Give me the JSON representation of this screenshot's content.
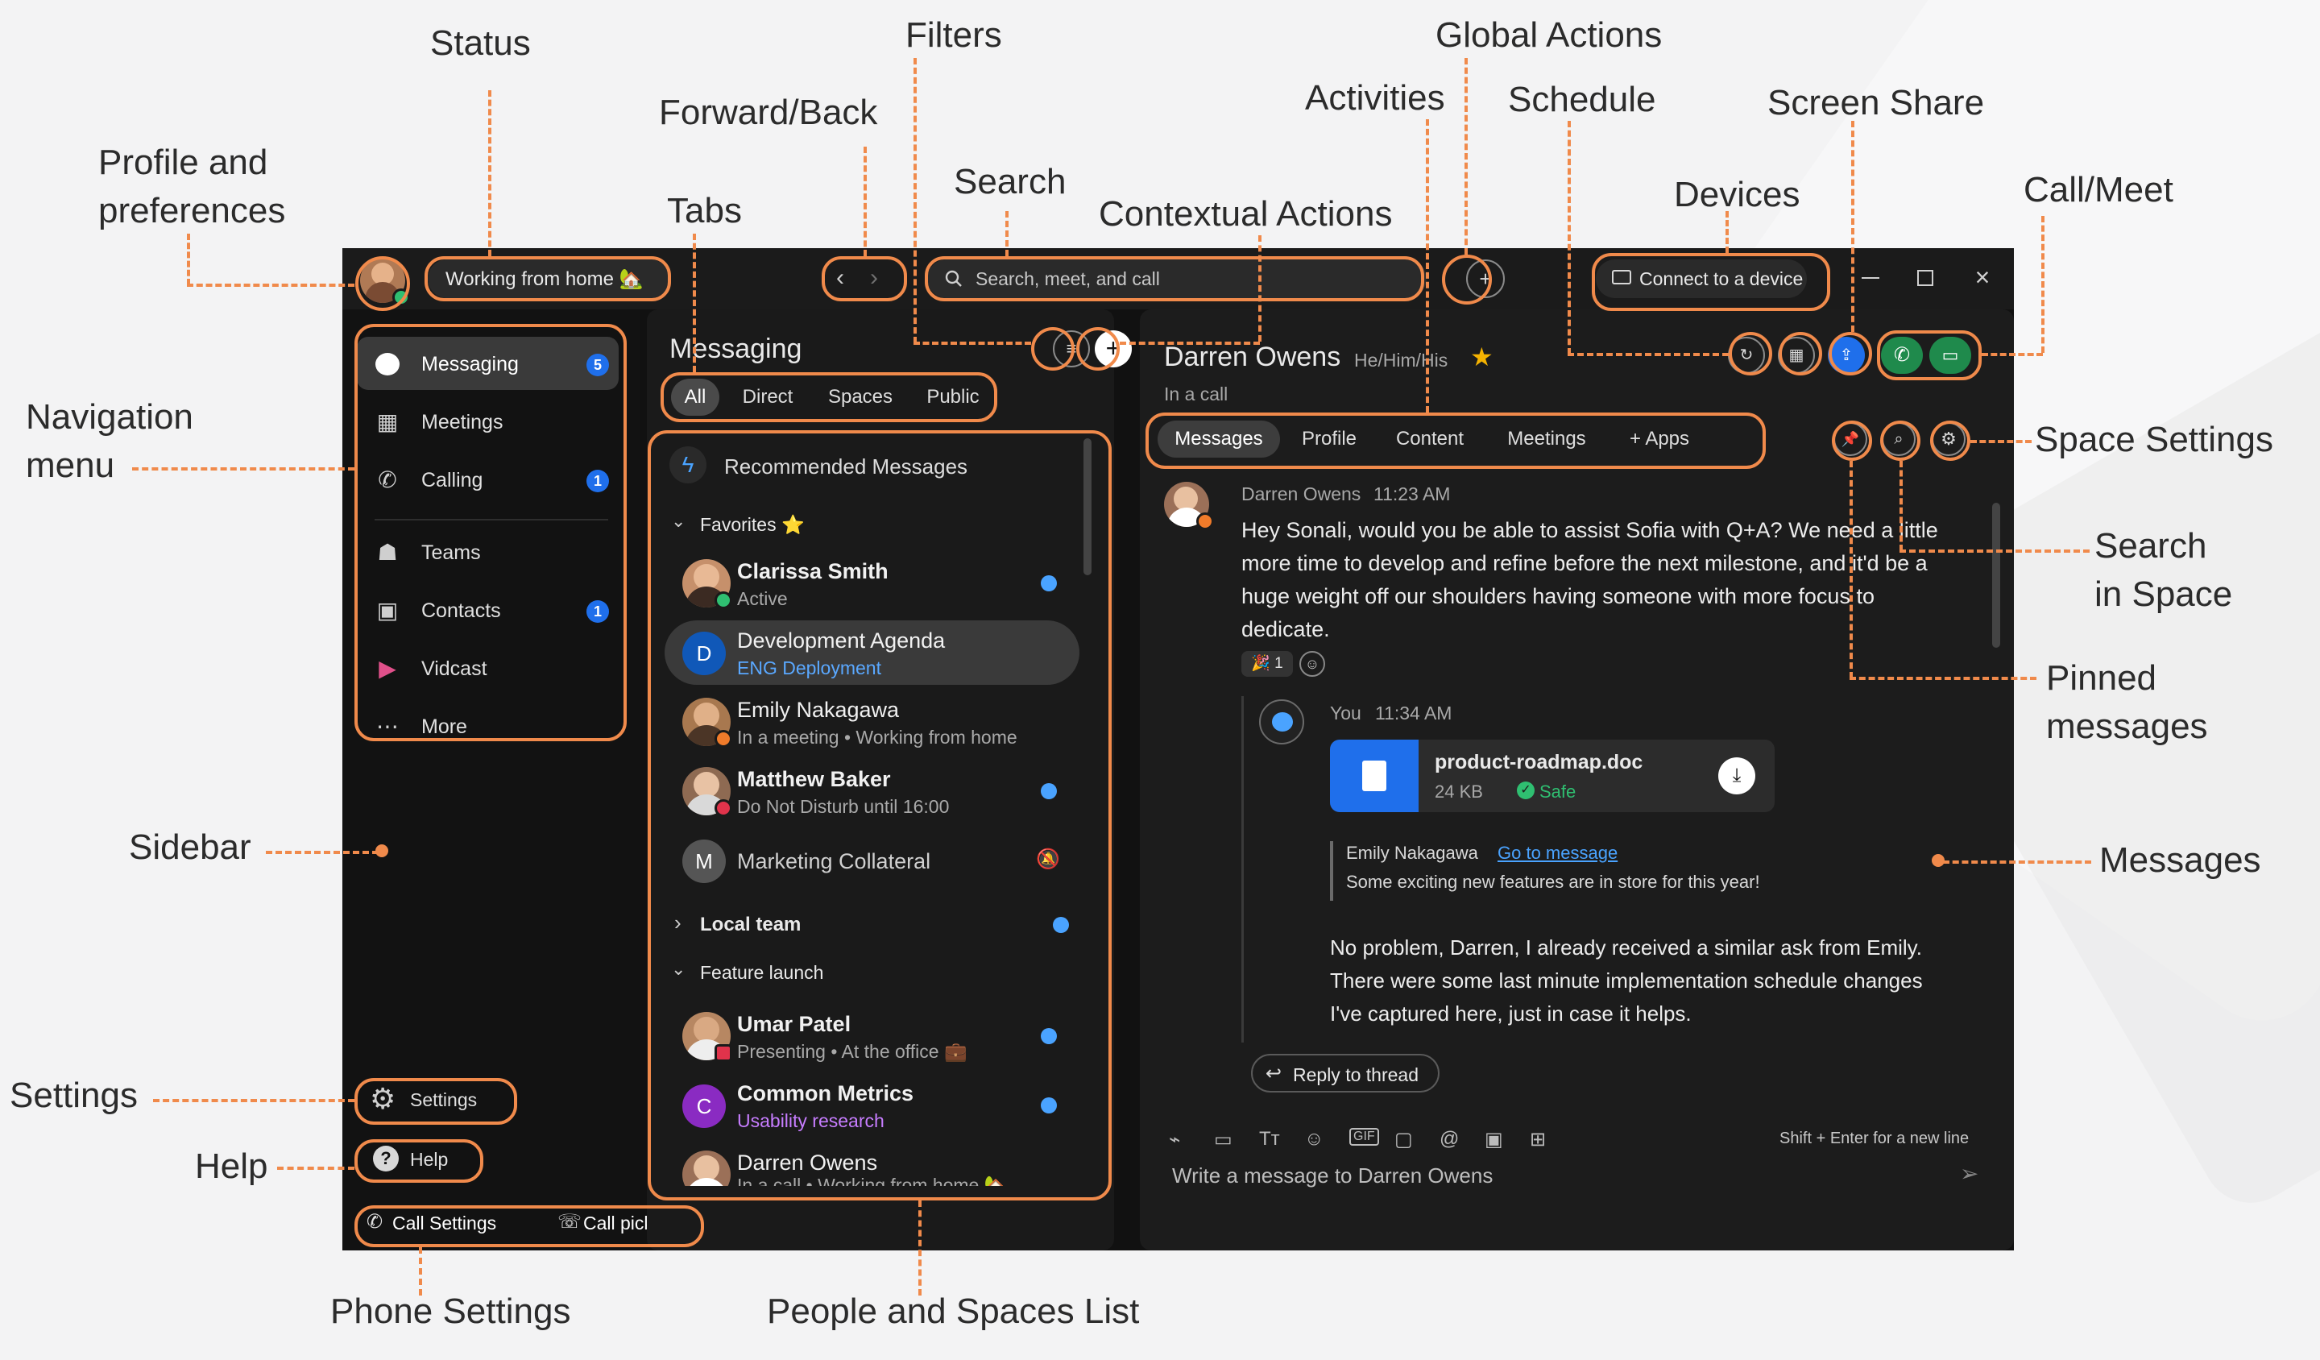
{
  "annotations": {
    "status": "Status",
    "filters": "Filters",
    "global_actions": "Global Actions",
    "forward_back": "Forward/Back",
    "activities": "Activities",
    "schedule": "Schedule",
    "screen_share": "Screen Share",
    "profile_line1": "Profile and",
    "profile_line2": "preferences",
    "search": "Search",
    "tabs": "Tabs",
    "contextual_actions": "Contextual Actions",
    "devices": "Devices",
    "call_meet": "Call/Meet",
    "navigation_line1": "Navigation",
    "navigation_line2": "menu",
    "space_settings": "Space Settings",
    "search_in_space_line1": "Search",
    "search_in_space_line2": "in Space",
    "pinned_line1": "Pinned",
    "pinned_line2": "messages",
    "sidebar": "Sidebar",
    "messages": "Messages",
    "settings": "Settings",
    "help": "Help",
    "phone_settings": "Phone Settings",
    "people_spaces_list": "People and Spaces List"
  },
  "titlebar": {
    "status": "Working from home 🏡",
    "search_placeholder": "Search, meet, and call",
    "connect_device": "Connect to a device"
  },
  "nav": {
    "items": [
      {
        "label": "Messaging",
        "badge": "5",
        "icon": "chat-bubble-icon"
      },
      {
        "label": "Meetings",
        "badge": "",
        "icon": "calendar-icon"
      },
      {
        "label": "Calling",
        "badge": "1",
        "icon": "phone-icon"
      },
      {
        "label": "Teams",
        "badge": "",
        "icon": "people-icon"
      },
      {
        "label": "Contacts",
        "badge": "1",
        "icon": "contact-card-icon"
      },
      {
        "label": "Vidcast",
        "badge": "",
        "icon": "vidcast-icon"
      },
      {
        "label": "More",
        "badge": "",
        "icon": "ellipsis-icon"
      }
    ],
    "settings": "Settings",
    "help": "Help",
    "call_settings": "Call Settings",
    "call_pickup": "Call pickup"
  },
  "messaging": {
    "title": "Messaging",
    "tabs": [
      "All",
      "Direct",
      "Spaces",
      "Public"
    ],
    "recommended": "Recommended Messages",
    "favorites": "Favorites ⭐",
    "rows": [
      {
        "name": "Clarissa Smith",
        "sub": "Active",
        "bold": true
      },
      {
        "name": "Development Agenda",
        "sub": "ENG Deployment",
        "initial": "D"
      },
      {
        "name": "Emily Nakagawa",
        "sub": "In a meeting  •  Working from home"
      },
      {
        "name": "Matthew Baker",
        "sub": "Do Not Disturb until 16:00",
        "bold": true
      },
      {
        "name": "Marketing Collateral",
        "initial": "M"
      }
    ],
    "local_team": "Local team",
    "feature_launch": "Feature launch",
    "rows2": [
      {
        "name": "Umar Patel",
        "sub": "Presenting  •  At the office 💼",
        "bold": true
      },
      {
        "name": "Common Metrics",
        "sub": "Usability research",
        "initial": "C",
        "bold": true
      },
      {
        "name": "Darren Owens",
        "sub": "In a call  •  Working from home 🏡"
      }
    ]
  },
  "chat": {
    "name": "Darren Owens",
    "pronouns": "He/Him/His",
    "status": "In a call",
    "tabs": [
      "Messages",
      "Profile",
      "Content",
      "Meetings",
      "+ Apps"
    ],
    "msg1_author": "Darren Owens",
    "msg1_time": "11:23 AM",
    "msg1_text": [
      "Hey Sonali, would you be able to assist Sofia with Q+A? We need a little",
      "more time to develop and refine before the next milestone, and it'd be a",
      "huge weight off our shoulders having someone with more focus to",
      "dedicate."
    ],
    "reaction": "🎉 1",
    "reply_author": "You",
    "reply_time": "11:34 AM",
    "file_name": "product-roadmap.doc",
    "file_size": "24 KB",
    "file_safe": "Safe",
    "quote_author": "Emily Nakagawa",
    "quote_link": "Go to message",
    "quote_text": "Some exciting new features are in store for this year!",
    "reply_text": [
      "No problem, Darren, I already received a similar ask from Emily.",
      "There were some last minute implementation schedule changes",
      "I've captured here, just in case it helps."
    ],
    "reply_thread": "Reply to thread",
    "composer_hint": "Shift + Enter for a new line",
    "composer_placeholder": "Write a message to Darren Owens"
  },
  "colors": {
    "annotation": "#f08a4b",
    "accent_blue": "#1f6feb",
    "call_green": "#1f8a4c",
    "purple": "#8a2bc2"
  }
}
